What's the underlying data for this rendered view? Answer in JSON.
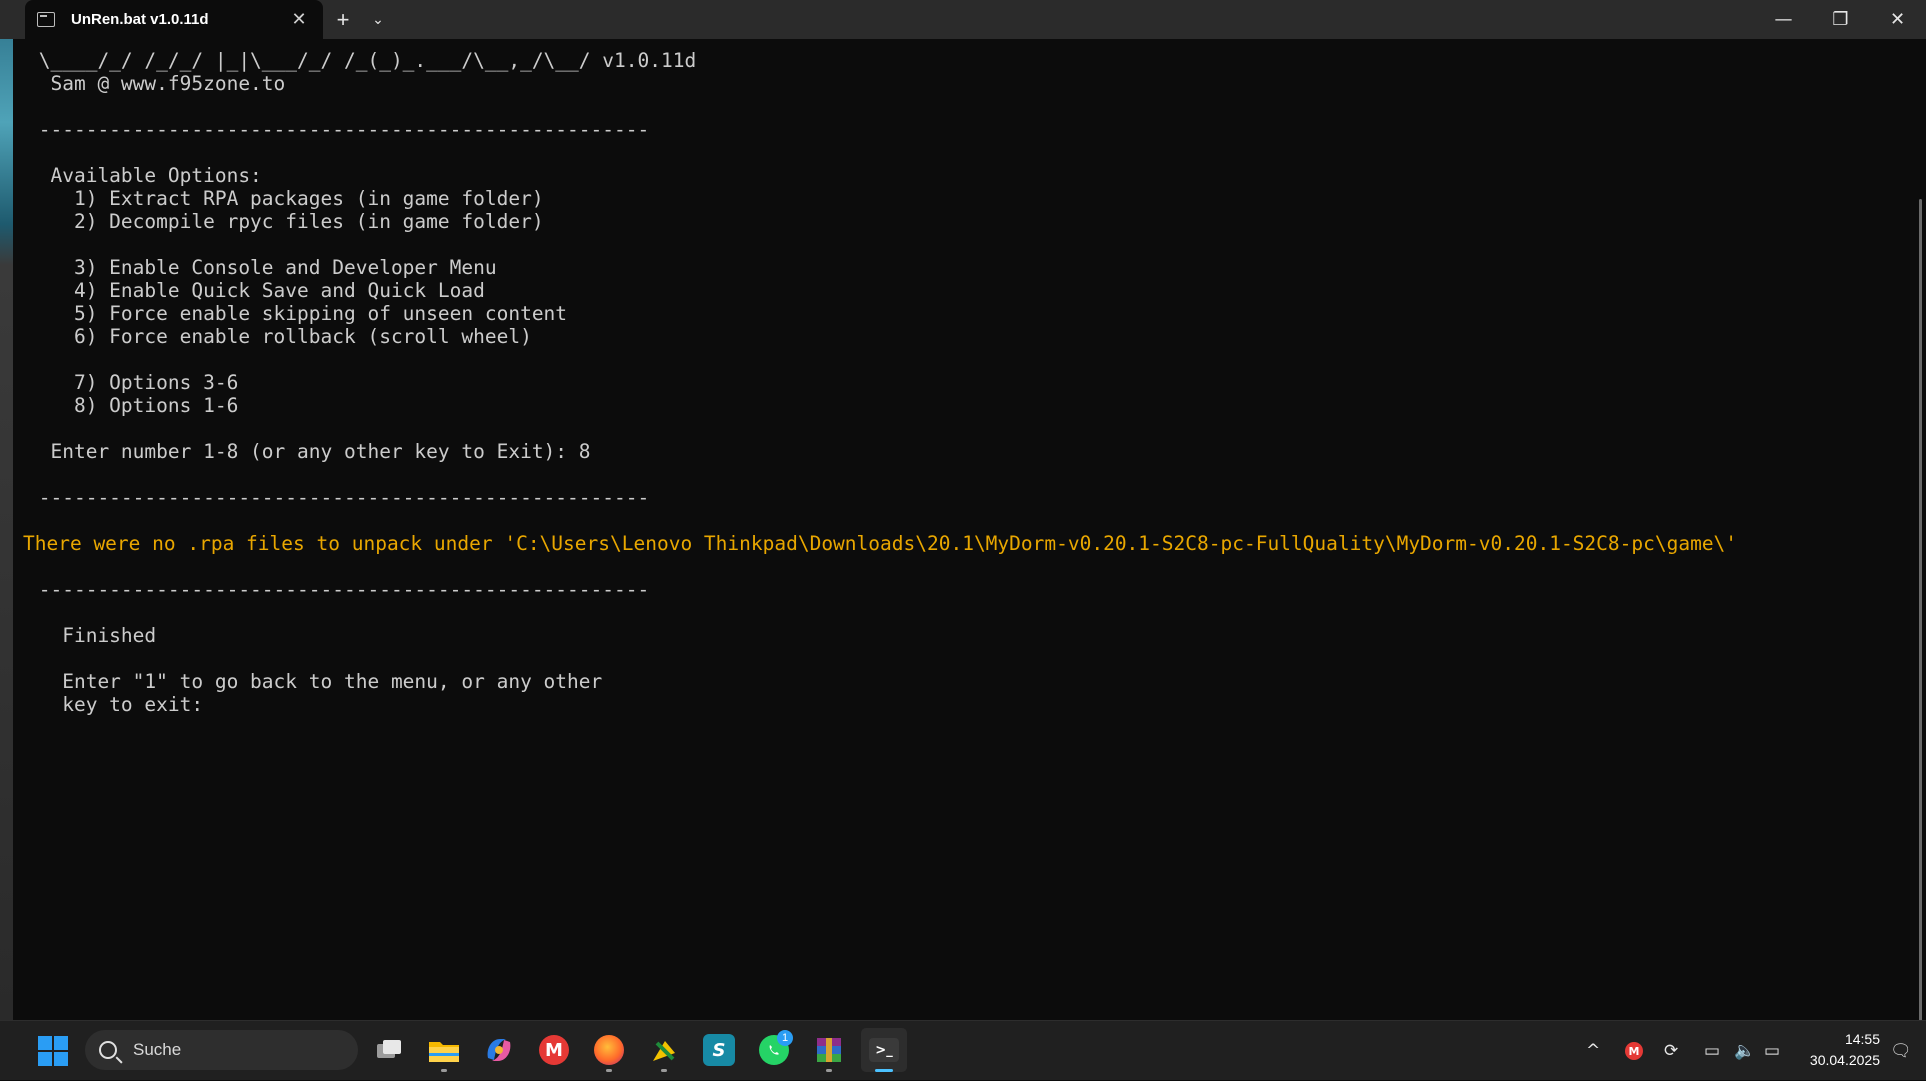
{
  "window": {
    "tab_title": "UnRen.bat v1.0.11d",
    "new_tab_label": "+",
    "dropdown_label": "⌄",
    "close_tab_label": "✕",
    "minimize_label": "—",
    "maximize_label": "❐",
    "close_label": "✕"
  },
  "console": {
    "lines": [
      " \\____/_/ /_/_/ |_|\\___/_/ /_(_)_.___/\\__,_/\\__/ v1.0.11d",
      "  Sam @ www.f95zone.to",
      "",
      " ----------------------------------------------------",
      "",
      "  Available Options:",
      "    1) Extract RPA packages (in game folder)",
      "    2) Decompile rpyc files (in game folder)",
      "",
      "    3) Enable Console and Developer Menu",
      "    4) Enable Quick Save and Quick Load",
      "    5) Force enable skipping of unseen content",
      "    6) Force enable rollback (scroll wheel)",
      "",
      "    7) Options 3-6",
      "    8) Options 1-6",
      "",
      "  Enter number 1-8 (or any other key to Exit): 8",
      "",
      " ----------------------------------------------------",
      "",
      "There were no .rpa files to unpack under 'C:\\Users\\Lenovo Thinkpad\\Downloads\\20.1\\MyDorm-v0.20.1-S2C8-pc-FullQuality\\MyDorm-v0.20.1-S2C8-pc\\game\\'",
      "",
      " ----------------------------------------------------",
      "",
      "",
      "   Finished",
      "",
      "   Enter \"1\" to go back to the menu, or any other",
      "   key to exit:"
    ]
  },
  "taskbar": {
    "search_placeholder": "Suche",
    "apps": [
      {
        "name": "task-view",
        "icon": "task-view-icon"
      },
      {
        "name": "file-explorer",
        "icon": "folder-icon"
      },
      {
        "name": "copilot",
        "icon": "copilot-icon"
      },
      {
        "name": "gmail",
        "icon": "gmail-icon"
      },
      {
        "name": "firefox",
        "icon": "firefox-icon"
      },
      {
        "name": "app-yellow",
        "icon": "app-icon"
      },
      {
        "name": "surfshark",
        "icon": "surfshark-icon"
      },
      {
        "name": "whatsapp",
        "icon": "whatsapp-icon",
        "badge": "1"
      },
      {
        "name": "winrar",
        "icon": "winrar-icon"
      },
      {
        "name": "terminal",
        "icon": "terminal-icon",
        "active": true
      }
    ],
    "tray": {
      "chevron": "^",
      "time": "14:55",
      "date": "30.04.2025"
    }
  },
  "colors": {
    "console_text": "#cccccc",
    "warning_text": "#e9a700",
    "background": "#0c0c0c",
    "accent": "#4cc2ff"
  }
}
